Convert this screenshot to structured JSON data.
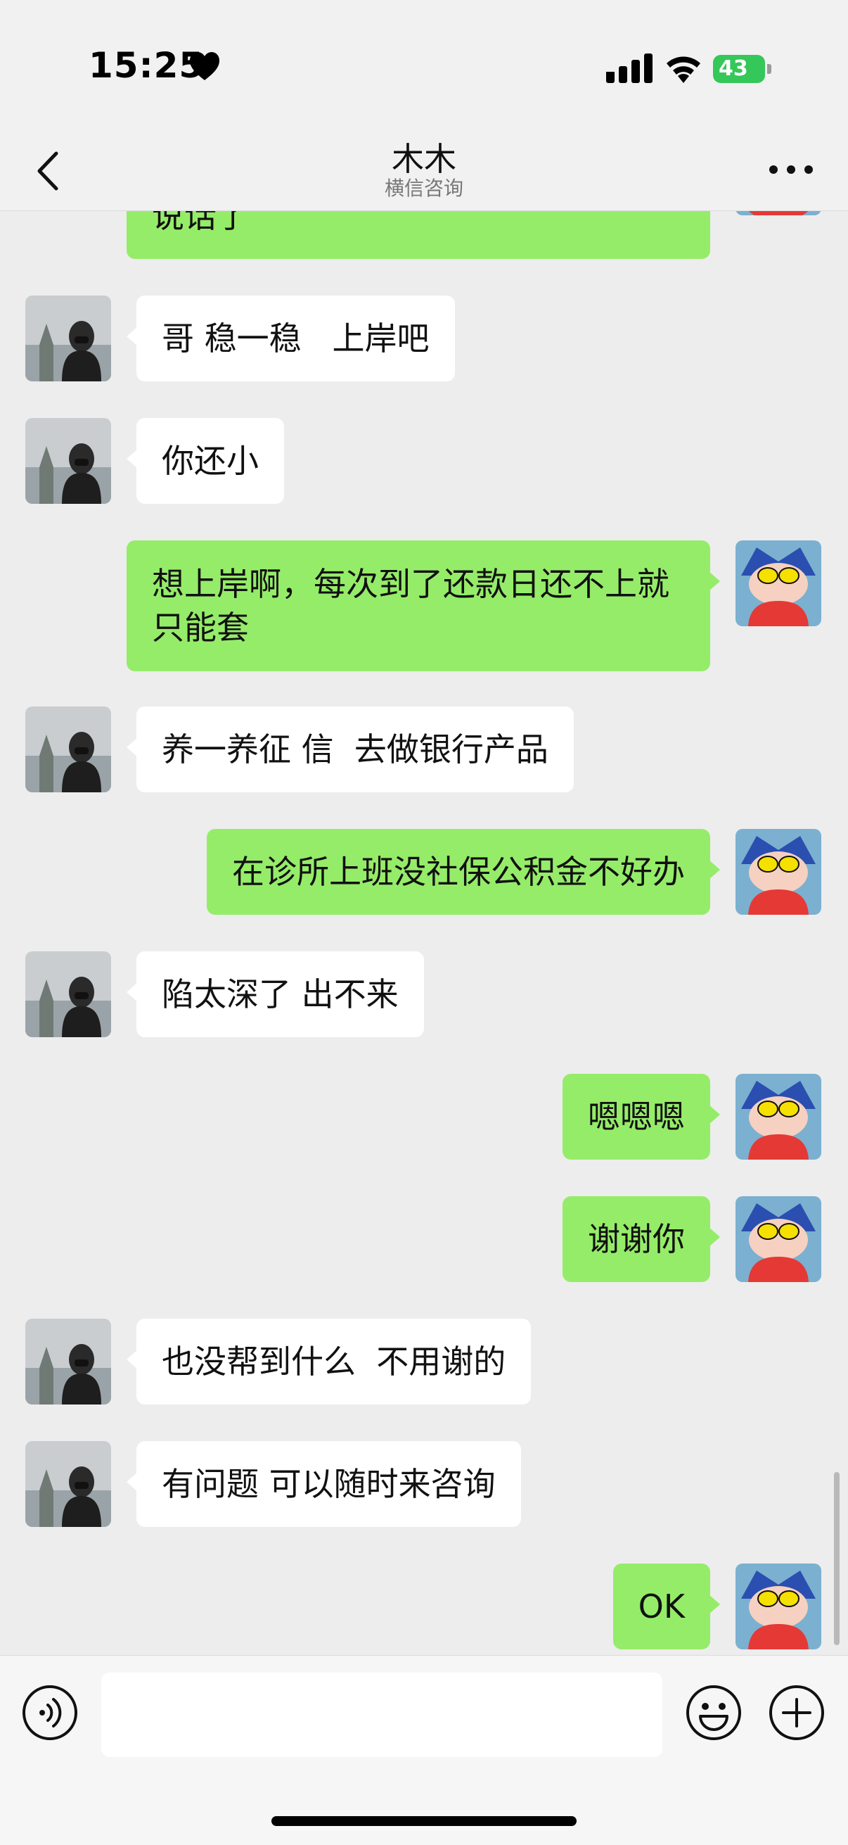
{
  "status": {
    "time": "15:25",
    "battery": "43"
  },
  "header": {
    "title": "木木",
    "subtitle": "横信咨询"
  },
  "messages": [
    {
      "side": "out",
      "text": "说话了"
    },
    {
      "side": "in",
      "text": "哥 稳一稳   上岸吧"
    },
    {
      "side": "in",
      "text": "你还小"
    },
    {
      "side": "out",
      "text": "想上岸啊，每次到了还款日还不上就只能套"
    },
    {
      "side": "in",
      "text": "养一养征 信  去做银行产品"
    },
    {
      "side": "out",
      "text": "在诊所上班没社保公积金不好办"
    },
    {
      "side": "in",
      "text": "陷太深了 出不来"
    },
    {
      "side": "out",
      "text": "嗯嗯嗯"
    },
    {
      "side": "out",
      "text": "谢谢你"
    },
    {
      "side": "in",
      "text": "也没帮到什么  不用谢的"
    },
    {
      "side": "in",
      "text": "有问题 可以随时来咨询"
    },
    {
      "side": "out",
      "text": "OK"
    }
  ],
  "input": {
    "value": "",
    "placeholder": ""
  },
  "icons": {
    "back": "chevron-left-icon",
    "more": "more-dots-icon",
    "voice": "voice-icon",
    "emoji": "emoji-icon",
    "plus": "plus-icon"
  },
  "colors": {
    "incoming_bubble": "#ffffff",
    "outgoing_bubble": "#95ec69",
    "background": "#ededed",
    "battery": "#34c759"
  }
}
